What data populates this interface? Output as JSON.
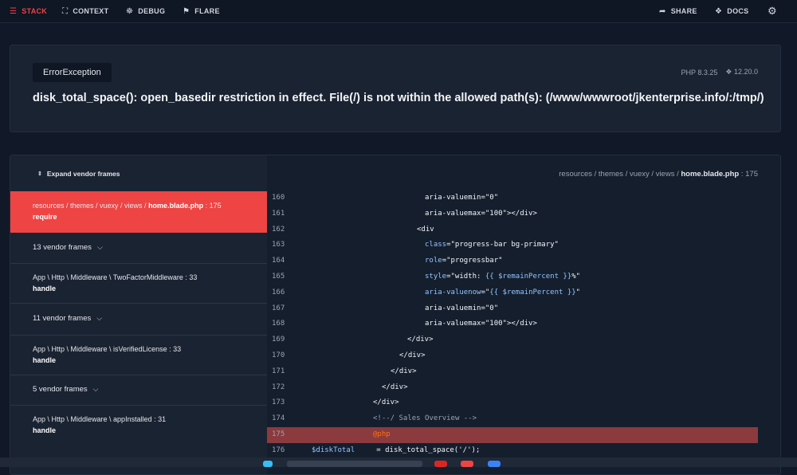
{
  "nav": {
    "stack": "STACK",
    "context": "CONTEXT",
    "debug": "DEBUG",
    "flare": "FLARE",
    "share": "SHARE",
    "docs": "DOCS"
  },
  "error": {
    "type": "ErrorException",
    "php_version": "PHP 8.3.25",
    "laravel_version": "12.20.0",
    "message": "disk_total_space(): open_basedir restriction in effect. File(/) is not within the allowed path(s): (/www/wwwroot/jkenterprise.info/:/tmp/)"
  },
  "stack": {
    "expand_label": "Expand vendor frames",
    "frames": [
      {
        "kind": "app",
        "path_prefix": "resources / themes / vuexy / views / ",
        "file": "home.blade.php",
        "line": " : 175",
        "fn": "require",
        "active": true
      },
      {
        "kind": "vendor",
        "label": "13 vendor frames"
      },
      {
        "kind": "app",
        "path_prefix": "App \\ Http \\ Middleware \\ ",
        "file": "TwoFactorMiddleware",
        "line": " : 33",
        "fn": "handle"
      },
      {
        "kind": "vendor",
        "label": "11 vendor frames"
      },
      {
        "kind": "app",
        "path_prefix": "App \\ Http \\ Middleware \\ ",
        "file": "isVerifiedLicense",
        "line": " : 33",
        "fn": "handle"
      },
      {
        "kind": "vendor",
        "label": "5 vendor frames"
      },
      {
        "kind": "app",
        "path_prefix": "App \\ Http \\ Middleware \\ ",
        "file": "appInstalled",
        "line": " : 31",
        "fn": "handle"
      }
    ]
  },
  "code": {
    "path_prefix": "resources / themes / vuexy / views / ",
    "file": "home.blade.php",
    "line": " : 175",
    "lines": [
      {
        "n": "160",
        "tokens": [
          {
            "t": "aria-valuemin",
            "c": "t-tag"
          },
          {
            "t": "=\"0\"",
            "c": "t-str"
          }
        ]
      },
      {
        "n": "161",
        "tokens": [
          {
            "t": "aria-valuemax",
            "c": "t-tag"
          },
          {
            "t": "=\"100\"></div>",
            "c": "t-str"
          }
        ]
      },
      {
        "n": "162",
        "tokens": [
          {
            "t": "<div",
            "c": "t-tag"
          }
        ]
      },
      {
        "n": "163",
        "tokens": [
          {
            "t": "class",
            "c": "t-attr"
          },
          {
            "t": "=\"progress-bar bg-primary\"",
            "c": "t-str"
          }
        ]
      },
      {
        "n": "164",
        "tokens": [
          {
            "t": "role",
            "c": "t-attr"
          },
          {
            "t": "=\"progressbar\"",
            "c": "t-str"
          }
        ]
      },
      {
        "n": "165",
        "tokens": [
          {
            "t": "style",
            "c": "t-attr"
          },
          {
            "t": "=\"width: ",
            "c": "t-str"
          },
          {
            "t": "{{ $remainPercent }}",
            "c": "t-var"
          },
          {
            "t": "%\"",
            "c": "t-str"
          }
        ]
      },
      {
        "n": "166",
        "tokens": [
          {
            "t": "aria-valuenow",
            "c": "t-attr"
          },
          {
            "t": "=\"",
            "c": "t-str"
          },
          {
            "t": "{{ $remainPercent }}",
            "c": "t-var"
          },
          {
            "t": "\"",
            "c": "t-str"
          }
        ]
      },
      {
        "n": "167",
        "tokens": [
          {
            "t": "aria-valuemin",
            "c": "t-tag"
          },
          {
            "t": "=\"0\"",
            "c": "t-str"
          }
        ]
      },
      {
        "n": "168",
        "tokens": [
          {
            "t": "aria-valuemax",
            "c": "t-tag"
          },
          {
            "t": "=\"100\"></div>",
            "c": "t-str"
          }
        ]
      },
      {
        "n": "169",
        "tokens": [
          {
            "t": "</div>",
            "c": "t-tag"
          }
        ]
      },
      {
        "n": "170",
        "tokens": [
          {
            "t": "</div>",
            "c": "t-tag"
          }
        ]
      },
      {
        "n": "171",
        "tokens": [
          {
            "t": "</div>",
            "c": "t-tag"
          }
        ]
      },
      {
        "n": "172",
        "tokens": [
          {
            "t": "</div>",
            "c": "t-tag"
          }
        ]
      },
      {
        "n": "173",
        "tokens": [
          {
            "t": "</div>",
            "c": "t-tag"
          }
        ]
      },
      {
        "n": "174",
        "tokens": [
          {
            "t": "<!--/ Sales Overview -->",
            "c": "t-com"
          }
        ]
      },
      {
        "n": "175",
        "highlight": true,
        "tokens": [
          {
            "t": "@php",
            "c": "t-dir"
          }
        ]
      },
      {
        "n": "176",
        "tokens": [
          {
            "t": "$diskTotal",
            "c": "t-var"
          },
          {
            "t": "     = disk_total_space('/');",
            "c": "t-tag"
          }
        ]
      }
    ]
  },
  "colors": {
    "accent": "#ef4444",
    "background": "#111827",
    "card": "#1a2332",
    "highlight_line": "#8b3a3e"
  }
}
